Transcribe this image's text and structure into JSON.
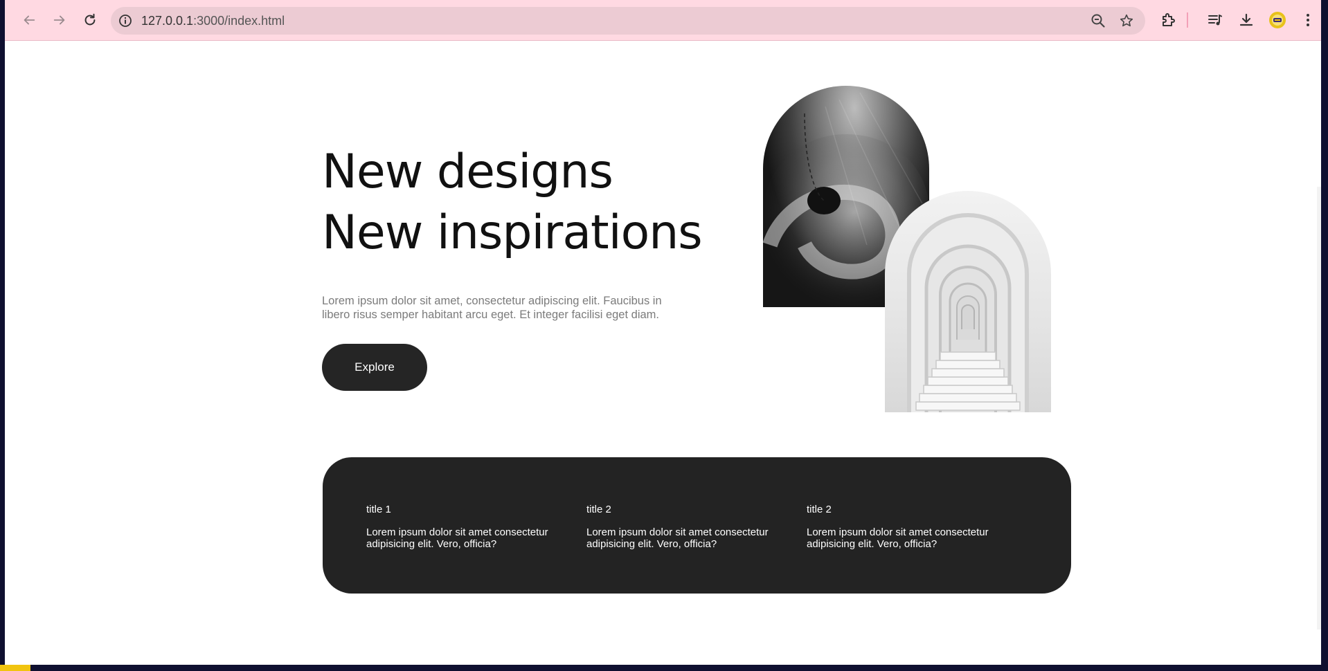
{
  "browser": {
    "url_host": "127.0.0.1",
    "url_path": ":3000/index.html",
    "icons": {
      "back": "arrow-left-icon",
      "forward": "arrow-right-icon",
      "reload": "reload-icon",
      "site_info": "info-icon",
      "zoom": "zoom-out-icon",
      "bookmark": "star-icon",
      "extensions": "puzzle-icon",
      "media": "media-queue-icon",
      "downloads": "download-icon",
      "profile": "avatar",
      "menu": "kebab-menu-icon"
    },
    "colors": {
      "toolbar": "#ffd9e2",
      "omnibox": "#eccbd3"
    }
  },
  "hero": {
    "title_line1": "New designs",
    "title_line2": "New inspirations",
    "description": "Lorem ipsum dolor sit amet, consectetur adipiscing elit. Faucibus in libero risus semper habitant arcu eget. Et integer facilisi eget diam.",
    "cta_label": "Explore"
  },
  "features": [
    {
      "title": "title 1",
      "text": "Lorem ipsum dolor sit amet consectetur adipisicing elit. Vero, officia?"
    },
    {
      "title": "title 2",
      "text": "Lorem ipsum dolor sit amet consectetur adipisicing elit. Vero, officia?"
    },
    {
      "title": "title 2",
      "text": "Lorem ipsum dolor sit amet consectetur adipisicing elit. Vero, officia?"
    }
  ],
  "theme": {
    "dark": "#232323",
    "muted_text": "#7b7b7b"
  }
}
